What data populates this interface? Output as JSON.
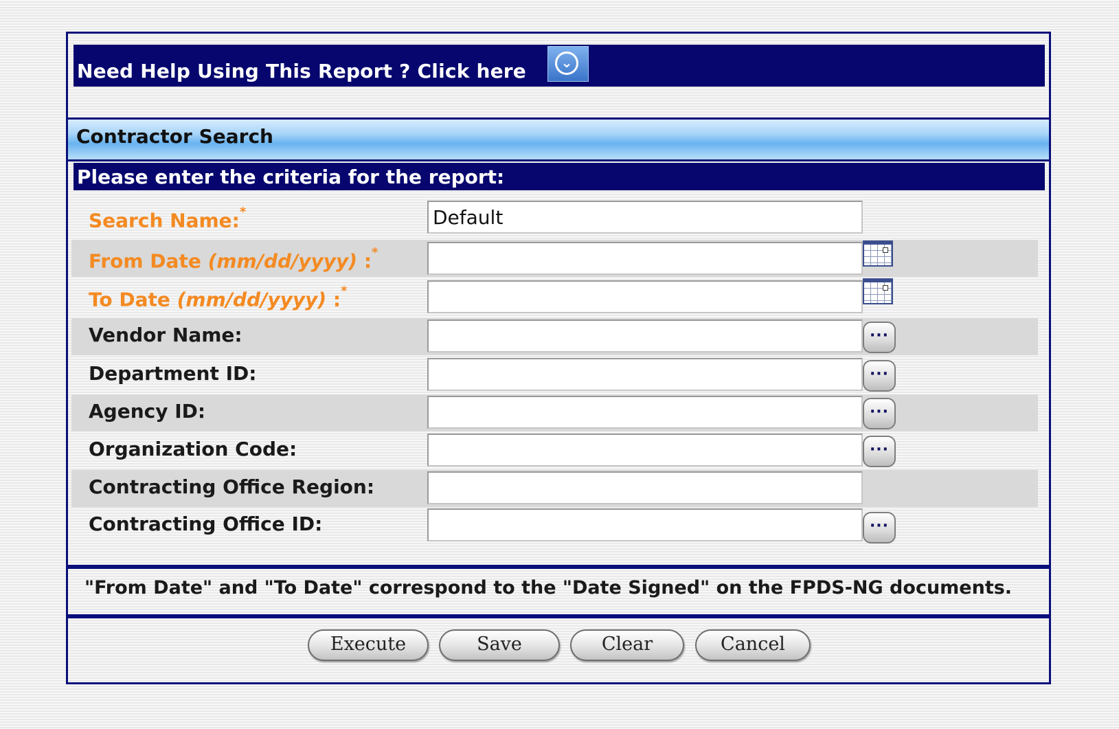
{
  "help": {
    "text": "Need Help Using This Report ? Click here",
    "icon": "expand-down-icon"
  },
  "section": {
    "title": "Contractor Search"
  },
  "criteria": {
    "header": "Please enter the criteria for the report:"
  },
  "fields": {
    "search_name": {
      "label": "Search Name:",
      "required_mark": "*",
      "value": "Default"
    },
    "from_date": {
      "label": "From Date ",
      "format": "(mm/dd/yyyy) ",
      "colon": ":",
      "required_mark": "*",
      "value": "",
      "icon": "calendar-icon"
    },
    "to_date": {
      "label": "To Date ",
      "format": "(mm/dd/yyyy) ",
      "colon": ":",
      "required_mark": "*",
      "value": "",
      "icon": "calendar-icon"
    },
    "vendor_name": {
      "label": "Vendor Name:",
      "value": "",
      "lookup": "···"
    },
    "department_id": {
      "label": "Department ID:",
      "value": "",
      "lookup": "···"
    },
    "agency_id": {
      "label": "Agency ID:",
      "value": "",
      "lookup": "···"
    },
    "organization_code": {
      "label": "Organization Code:",
      "value": "",
      "lookup": "···"
    },
    "contracting_office_region": {
      "label": "Contracting Office Region:",
      "value": ""
    },
    "contracting_office_id": {
      "label": "Contracting Office ID:",
      "value": "",
      "lookup": "···"
    }
  },
  "note": {
    "text": "\"From Date\" and \"To Date\" correspond to the \"Date Signed\" on the FPDS-NG documents."
  },
  "buttons": {
    "execute": "Execute",
    "save": "Save",
    "clear": "Clear",
    "cancel": "Cancel"
  },
  "colors": {
    "header_navy": "#06066e",
    "panel_border": "#0a0f7a",
    "required_orange": "#f48a22",
    "row_shade": "#d9d9d9"
  }
}
